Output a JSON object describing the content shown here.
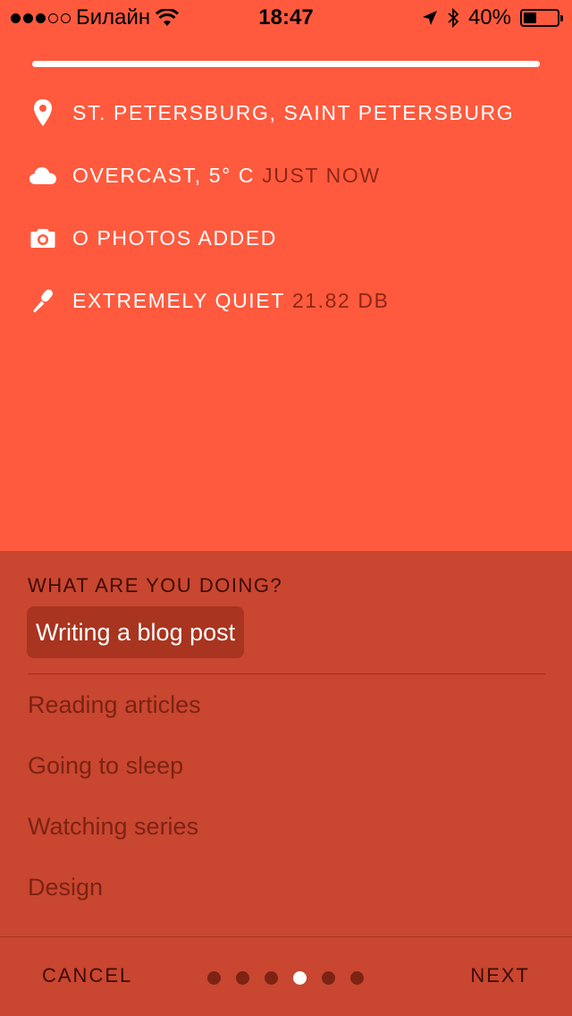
{
  "status_bar": {
    "carrier": "Билайн",
    "time": "18:47",
    "battery": "40%",
    "battery_level": 0.4
  },
  "progress": 1.0,
  "info": {
    "location": {
      "icon": "location-pin-icon",
      "text": "ST. PETERSBURG, SAINT PETERSBURG"
    },
    "weather": {
      "icon": "cloud-icon",
      "text": "OVERCAST, 5° C",
      "extra": "JUST NOW"
    },
    "photos": {
      "icon": "camera-icon",
      "text": "O PHOTOS ADDED"
    },
    "noise": {
      "icon": "microphone-icon",
      "text": "EXTREMELY QUIET",
      "extra": "21.82 DB"
    }
  },
  "activity": {
    "question": "WHAT ARE YOU DOING?",
    "selected": "Writing a blog post",
    "options": [
      "Reading articles",
      "Going to sleep",
      "Watching series",
      "Design"
    ]
  },
  "footer": {
    "cancel_label": "CANCEL",
    "next_label": "NEXT",
    "pages": 6,
    "current_page": 4
  },
  "colors": {
    "background": "#ff5a3e",
    "panel": "#c94630",
    "chip": "#a9341f",
    "muted_text": "#7c2313"
  }
}
